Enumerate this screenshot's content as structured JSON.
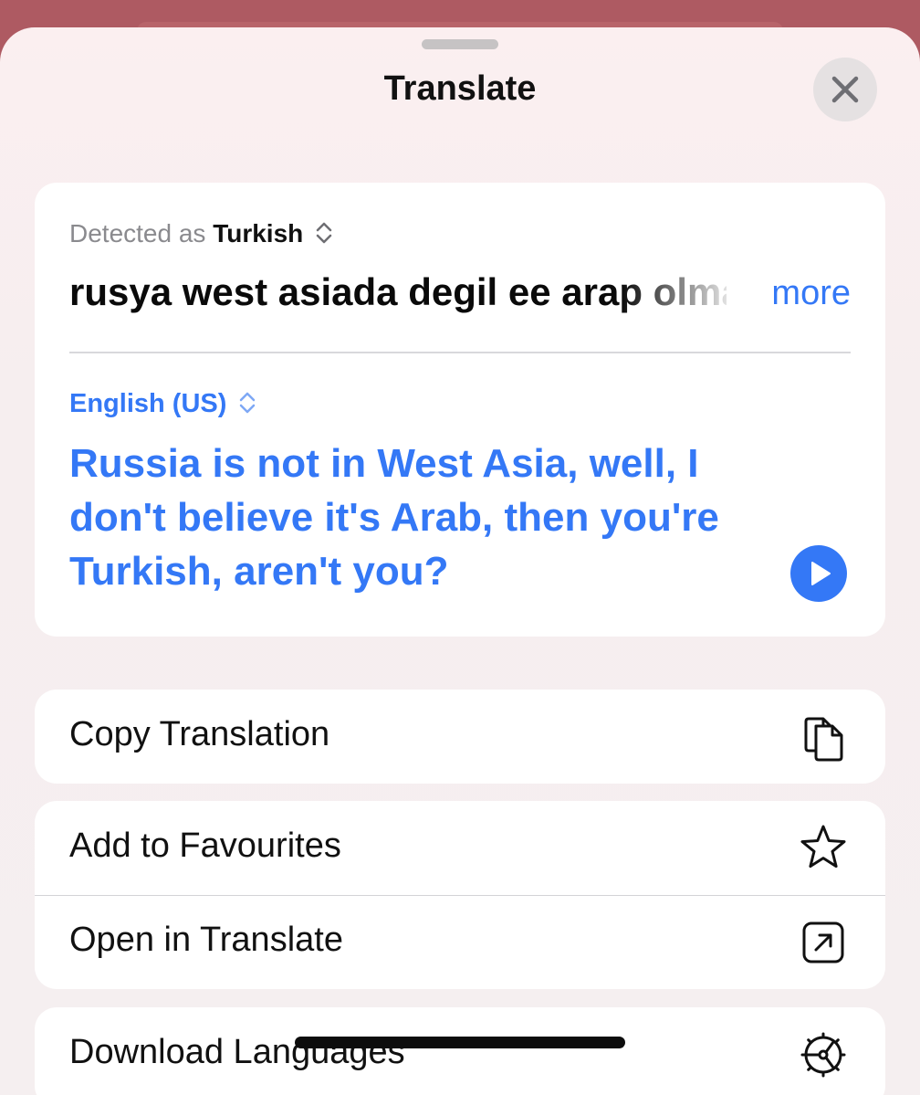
{
  "sheet": {
    "title": "Translate",
    "close_icon": "close-icon"
  },
  "translation_card": {
    "detected_prefix": "Detected as",
    "detected_language": "Turkish",
    "source_text": "rusya west asiada degil ee arap olmadigina inanmiyorum",
    "more_label": "more",
    "target_language": "English (US)",
    "translated_text": "Russia is not in West Asia, well, I don't believe it's Arab, then you're Turkish, aren't you?",
    "accent_color": "#3478f6",
    "play_icon": "play-icon"
  },
  "actions": [
    {
      "label": "Copy Translation",
      "icon": "copy-icon"
    },
    {
      "label": "Add to Favourites",
      "icon": "star-icon"
    },
    {
      "label": "Open in Translate",
      "icon": "open-external-icon"
    },
    {
      "label": "Download Languages",
      "icon": "download-languages-icon"
    }
  ]
}
